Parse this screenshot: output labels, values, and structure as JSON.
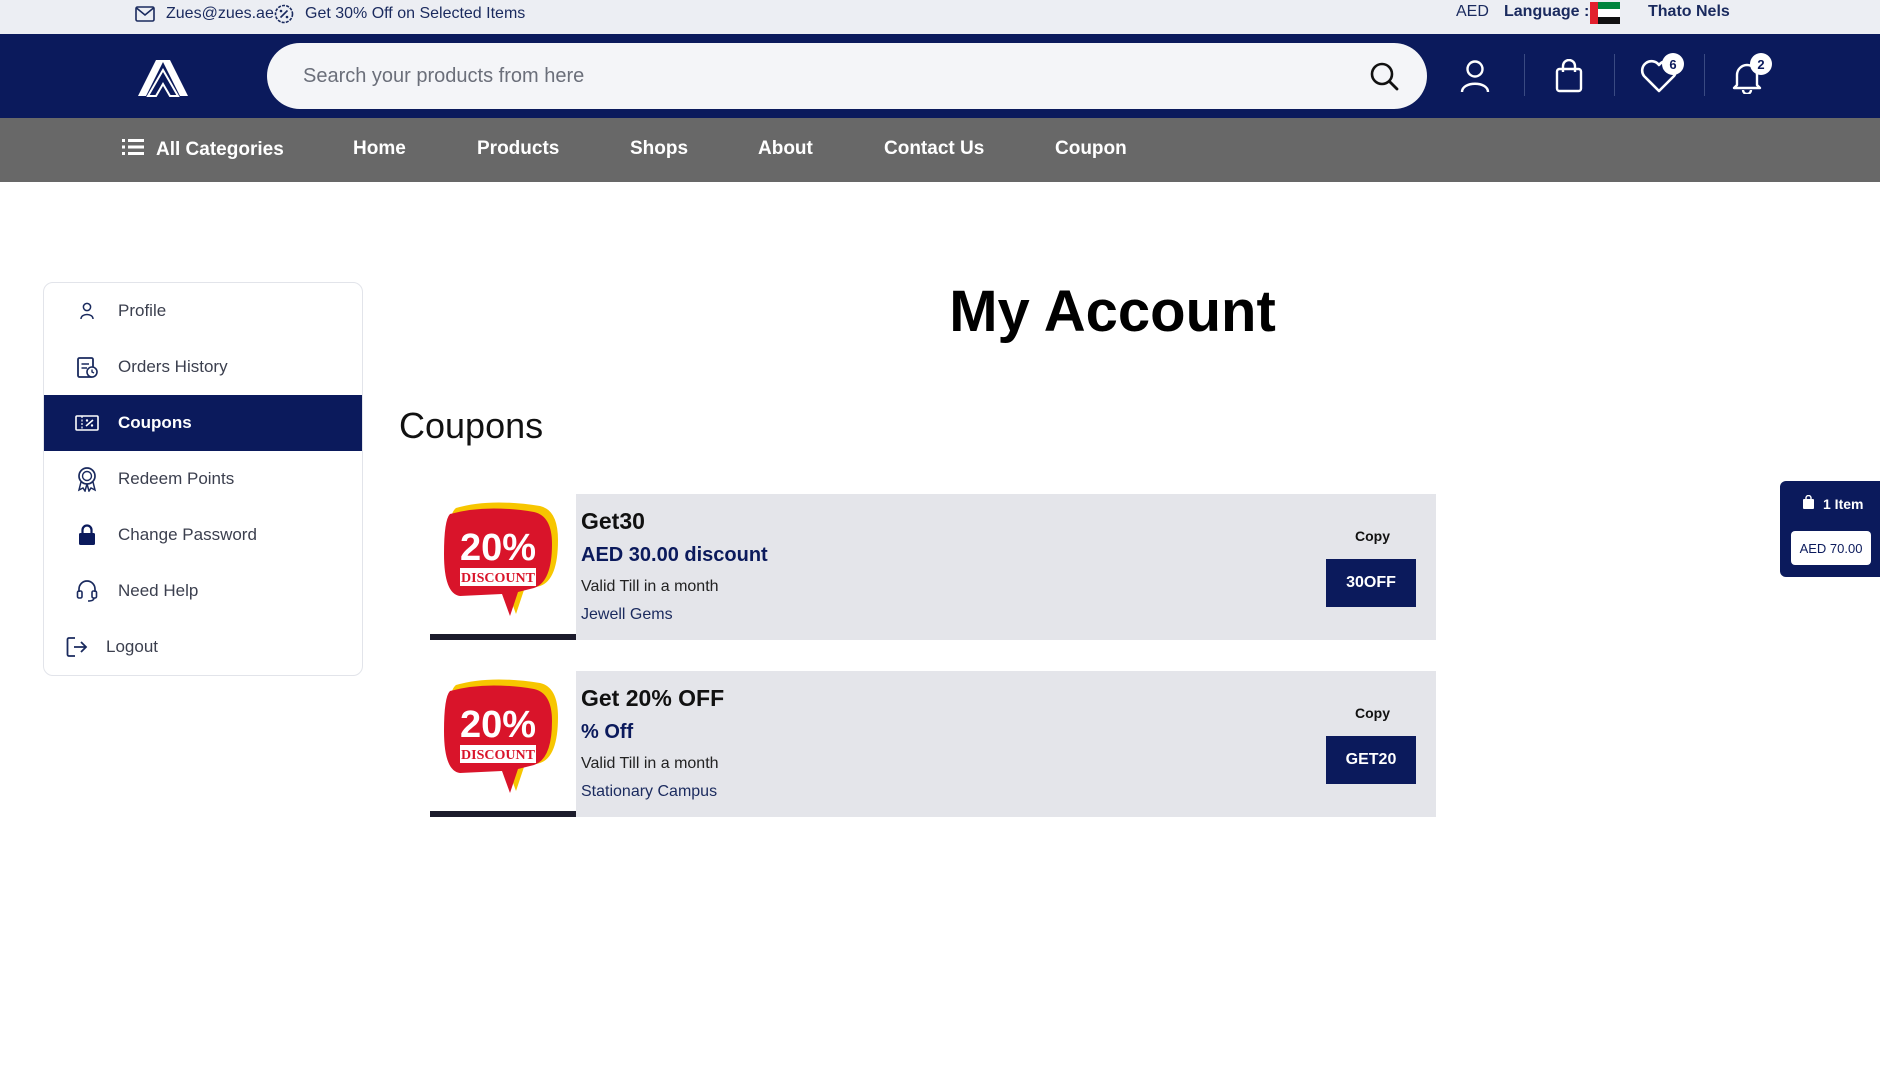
{
  "topbar": {
    "email": "Zues@zues.ae",
    "promo": "Get 30% Off on Selected Items",
    "currency": "AED",
    "language_label": "Language :",
    "user_name": "Thato Nels"
  },
  "header": {
    "search_placeholder": "Search your products from here",
    "wishlist_count": "6",
    "notifications_count": "2"
  },
  "nav": {
    "all_categories": "All Categories",
    "items": [
      "Home",
      "Products",
      "Shops",
      "About",
      "Contact Us",
      "Coupon"
    ]
  },
  "sidebar": {
    "items": [
      {
        "label": "Profile",
        "icon": "user-icon"
      },
      {
        "label": "Orders History",
        "icon": "orders-icon"
      },
      {
        "label": "Coupons",
        "icon": "coupon-icon",
        "active": true
      },
      {
        "label": "Redeem Points",
        "icon": "award-icon"
      },
      {
        "label": "Change Password",
        "icon": "lock-icon"
      },
      {
        "label": "Need Help",
        "icon": "headset-icon"
      },
      {
        "label": "Logout",
        "icon": "logout-icon"
      }
    ]
  },
  "main": {
    "title": "My Account",
    "section_title": "Coupons"
  },
  "coupons": [
    {
      "name": "Get30",
      "amount": "AED 30.00 discount",
      "validity": "Valid Till in a month",
      "shop": "Jewell Gems",
      "copy_label": "Copy",
      "code": "30OFF",
      "image_text_big": "20%",
      "image_text_small": "DISCOUNT"
    },
    {
      "name": "Get 20% OFF",
      "amount": "% Off",
      "validity": "Valid Till in a month",
      "shop": "Stationary Campus",
      "copy_label": "Copy",
      "code": "GET20",
      "image_text_big": "20%",
      "image_text_small": "DISCOUNT"
    }
  ],
  "floating_cart": {
    "items_label": "1 Item",
    "total": "AED 70.00"
  },
  "colors": {
    "brand_navy": "#0b1a5c",
    "nav_gray": "#686868",
    "coupon_bg": "#e4e5ea",
    "discount_red": "#d9142a",
    "discount_yellow": "#f7c600"
  }
}
